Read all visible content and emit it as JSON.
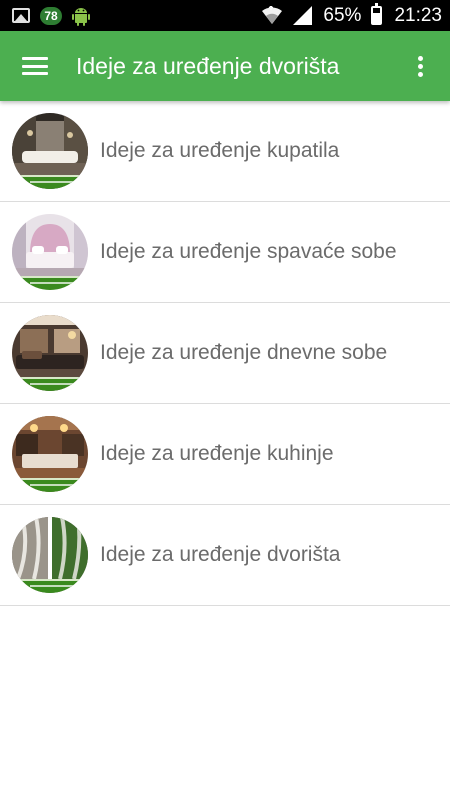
{
  "status_bar": {
    "notification_badge": "78",
    "battery_percent": "65%",
    "time": "21:23",
    "icons": [
      "image-icon",
      "android-icon",
      "wifi-icon",
      "signal-icon",
      "battery-icon"
    ]
  },
  "app_bar": {
    "title": "Ideje za uređenje dvorišta",
    "background_color": "#4caf50",
    "icons": [
      "menu-icon",
      "overflow-menu-icon"
    ]
  },
  "list": {
    "items": [
      {
        "label": "Ideje za uređenje kupatila",
        "thumbnail_theme": "bathroom"
      },
      {
        "label": "Ideje za uređenje spavaće sobe",
        "thumbnail_theme": "bedroom"
      },
      {
        "label": "Ideje za uređenje dnevne sobe",
        "thumbnail_theme": "living-room"
      },
      {
        "label": "Ideje za uređenje kuhinje",
        "thumbnail_theme": "kitchen"
      },
      {
        "label": "Ideje za uređenje dvorišta",
        "thumbnail_theme": "yard"
      }
    ]
  }
}
